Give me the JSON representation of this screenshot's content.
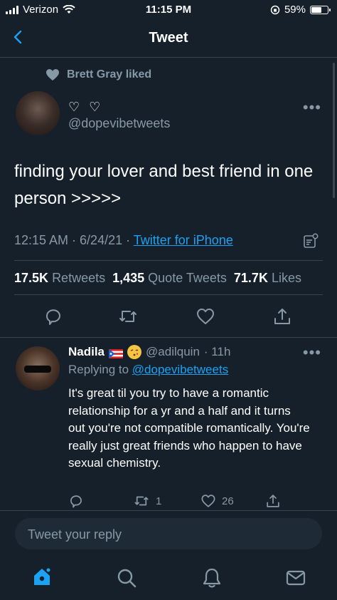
{
  "status_bar": {
    "carrier": "Verizon",
    "time": "11:15 PM",
    "battery": "59%"
  },
  "header": {
    "title": "Tweet"
  },
  "social_context": {
    "text": "Brett Gray liked"
  },
  "tweet": {
    "display_name": "♡ ♡",
    "handle": "@dopevibetweets",
    "text": "finding your lover and best friend in one person >>>>>",
    "time": "12:15 AM · 6/24/21 · ",
    "source": "Twitter for iPhone",
    "retweets_count": "17.5K",
    "retweets_label": "Retweets",
    "quotes_count": "1,435",
    "quotes_label": "Quote Tweets",
    "likes_count": "71.7K",
    "likes_label": "Likes",
    "more": "•••"
  },
  "reply": {
    "name": "Nadila",
    "handle": "@adilquin",
    "time": "· 11h",
    "replying_label": "Replying to",
    "replying_handle": "@dopevibetweets",
    "text": "It's great til you try to have a romantic relationship for a yr and a half and it turns out you're not compatible romantically. You're really just great friends who happen to have sexual chemistry.",
    "retweets": "1",
    "likes": "26",
    "more": "•••"
  },
  "composer": {
    "placeholder": "Tweet your reply"
  },
  "colors": {
    "background": "#15202b",
    "accent": "#1da1f2",
    "muted": "#8899a6",
    "divider": "#38444d"
  },
  "icons": [
    "back-arrow-icon",
    "heart-icon",
    "more-icon",
    "analytics-icon",
    "reply-icon",
    "retweet-icon",
    "like-icon",
    "share-icon",
    "home-icon",
    "search-icon",
    "notifications-icon",
    "messages-icon"
  ]
}
